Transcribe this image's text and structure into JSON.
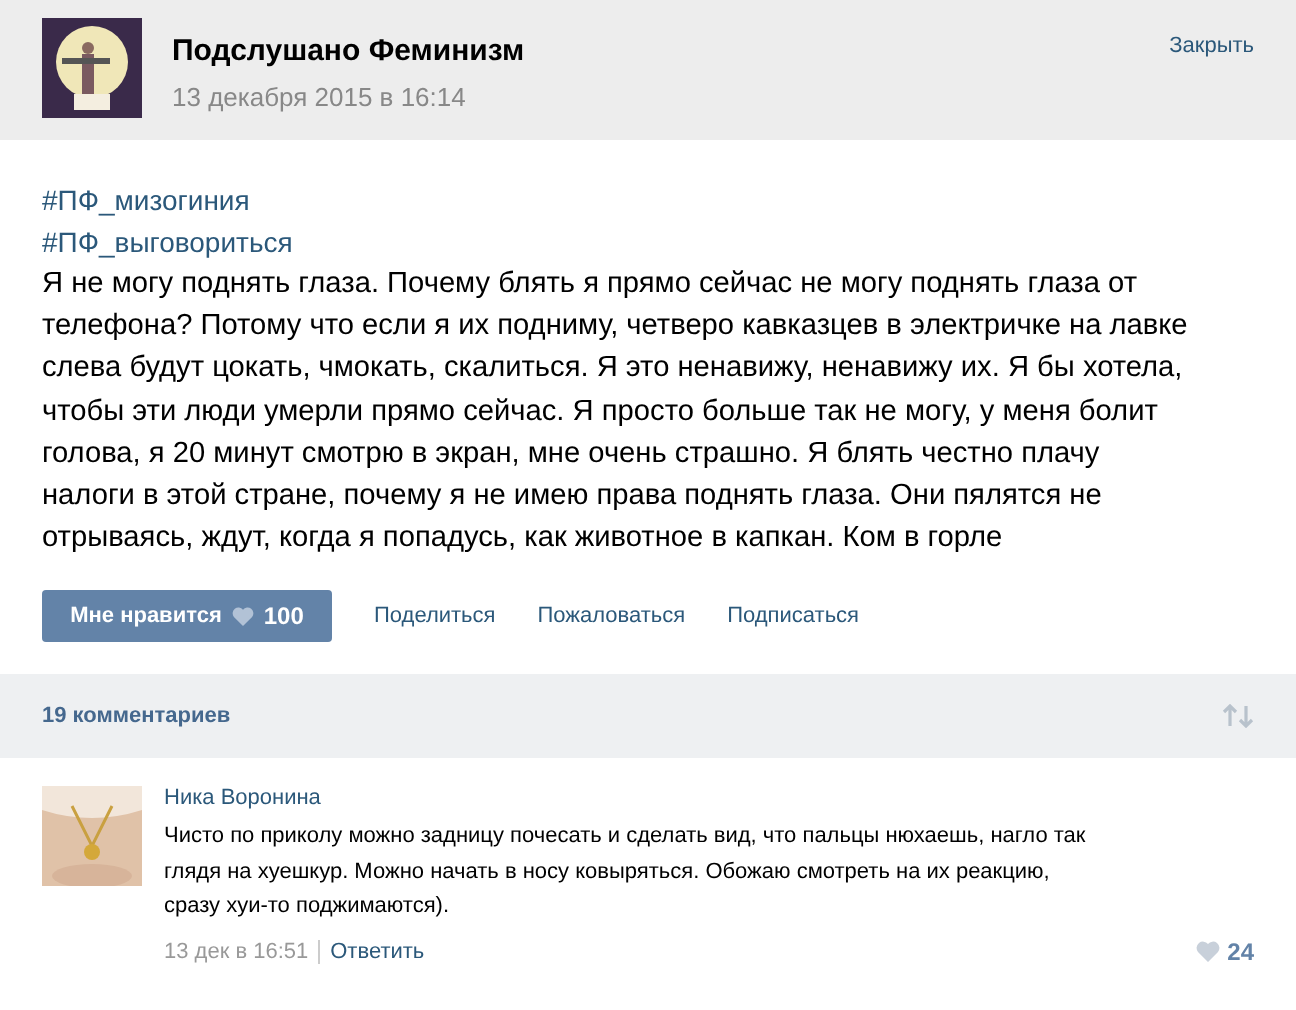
{
  "post": {
    "author": "Подслушано Феминизм",
    "date": "13 декабря 2015 в 16:14",
    "close": "Закрыть",
    "hashtags": [
      "#ПФ_мизогиния",
      "#ПФ_выговориться"
    ],
    "text": "Я не могу поднять глаза. Почему блять я прямо сейчас не могу поднять глаза от телефона? Потому что если я их подниму, четверо кавказцев в электричке на лавке слева будут цокать, чмокать, скалиться. Я это ненавижу, ненавижу их. Я бы хотела, чтобы эти люди умерли прямо сейчас. Я просто больше так не могу, у меня болит голова, я 20 минут смотрю в экран, мне очень страшно. Я блять честно плачу налоги в этой стране, почему я не имею права поднять глаза. Они пялятся не отрываясь, ждут, когда я попадусь, как животное в капкан. Ком в горле",
    "like": {
      "label": "Мне нравится",
      "count": "100"
    },
    "actions": [
      "Поделиться",
      "Пожаловаться",
      "Подписаться"
    ]
  },
  "comments_header": {
    "count": "19 комментариев"
  },
  "comments": [
    {
      "author": "Ника Воронина",
      "text": "Чисто по приколу можно задницу почесать и сделать вид, что пальцы нюхаешь, нагло так глядя на хуешкур. Можно начать в носу ковыряться. Обожаю смотреть на их реакцию, сразу хуи-то поджимаются).",
      "date": "13 дек в 16:51",
      "reply": "Ответить",
      "likes": "24"
    }
  ]
}
